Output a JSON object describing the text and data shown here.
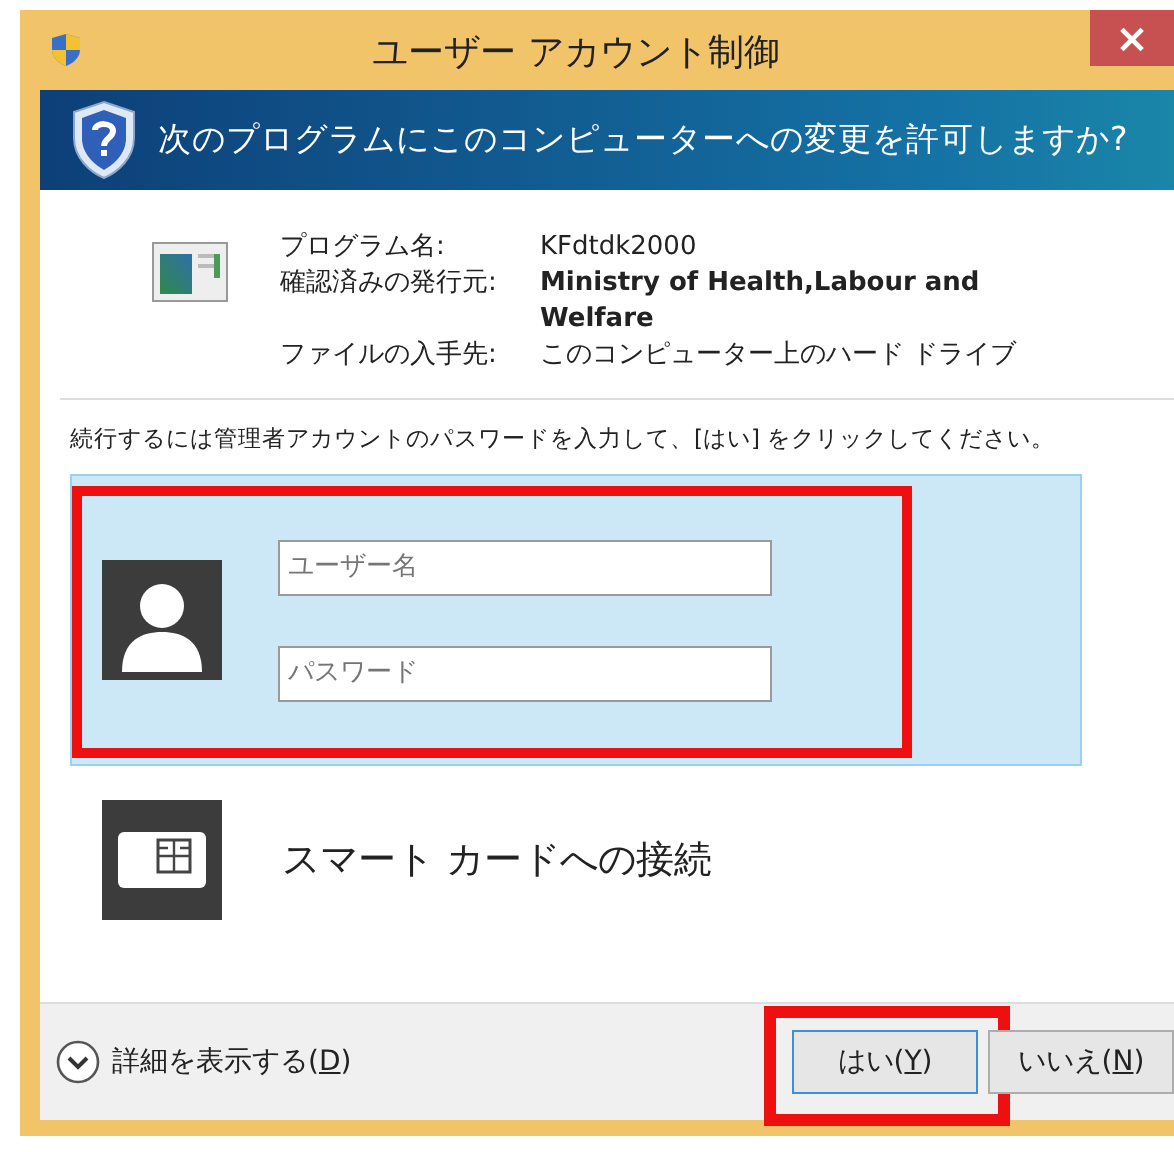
{
  "window": {
    "title": "ユーザー アカウント制御",
    "close": "×"
  },
  "banner": {
    "question": "次のプログラムにこのコンピューターへの変更を許可しますか?"
  },
  "details": [
    {
      "label": "プログラム名:",
      "value": "KFdtdk2000",
      "bold": false
    },
    {
      "label": "確認済みの発行元:",
      "value": "Ministry of Health,Labour and Welfare",
      "bold": true
    },
    {
      "label": "ファイルの入手先:",
      "value": "このコンピューター上のハード ドライブ",
      "bold": false
    }
  ],
  "instruction": "続行するには管理者アカウントのパスワードを入力して、[はい] をクリックしてください。",
  "credentials": [
    {
      "kind": "password",
      "selected": true,
      "highlighted": true,
      "fields": [
        {
          "placeholder": "ユーザー名"
        },
        {
          "placeholder": "パスワード"
        }
      ]
    },
    {
      "kind": "smartcard",
      "selected": false,
      "highlighted": false,
      "label": "スマート カードへの接続"
    }
  ],
  "footer": {
    "details": {
      "before": "詳細を表示する(",
      "key": "D",
      "after": ")"
    },
    "buttons": [
      {
        "before": "はい(",
        "key": "Y",
        "after": ")",
        "default": true,
        "highlighted": true
      },
      {
        "before": "いいえ(",
        "key": "N",
        "after": ")",
        "default": false,
        "highlighted": false
      }
    ]
  }
}
